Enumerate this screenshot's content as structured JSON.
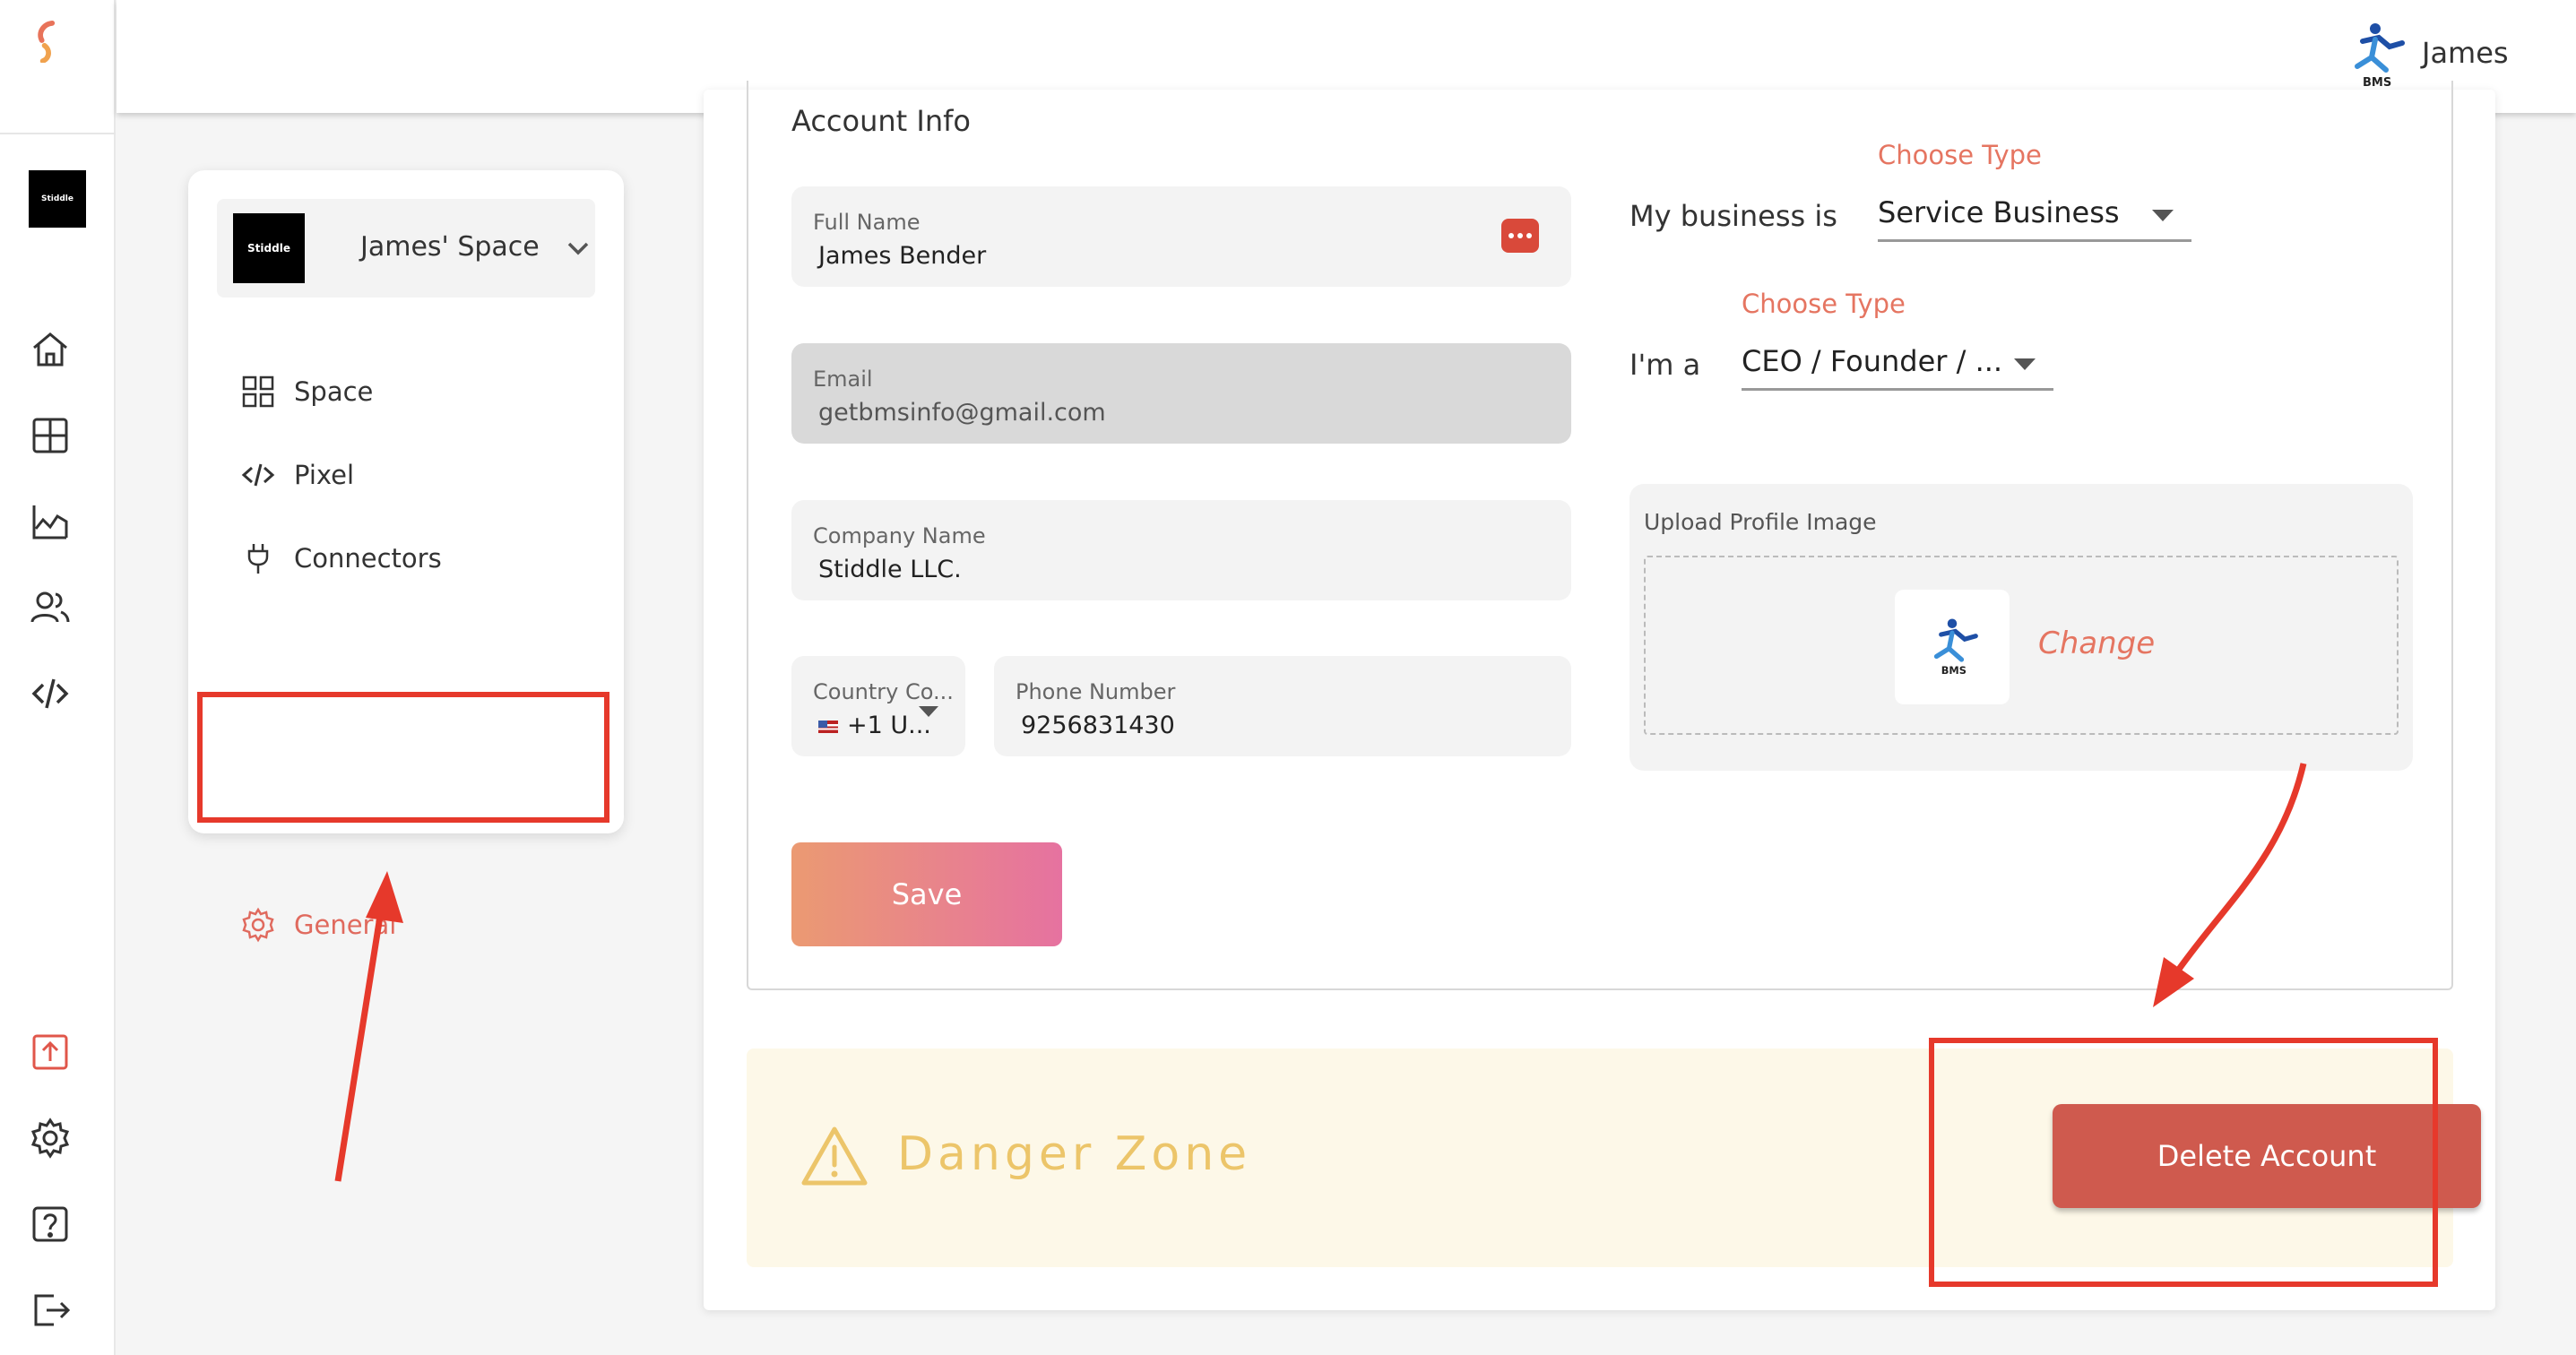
{
  "user": {
    "name": "James",
    "avatar_icon": "bms-logo-icon",
    "avatar_caption": "BMS"
  },
  "rail": {
    "workspace_thumb": "Stiddle",
    "icons": [
      "home-icon",
      "dashboard-icon",
      "analytics-icon",
      "users-icon",
      "code-icon",
      "upload-icon",
      "settings-icon",
      "help-icon",
      "logout-icon"
    ]
  },
  "space_menu": {
    "workspace_name": "James' Space",
    "workspace_thumb": "Stiddle",
    "items": [
      {
        "label": "Space",
        "icon": "grid-icon"
      },
      {
        "label": "Pixel",
        "icon": "code-icon"
      },
      {
        "label": "Connectors",
        "icon": "plug-icon"
      }
    ],
    "general_label": "General"
  },
  "account": {
    "section_title": "Account Info",
    "full_name": {
      "label": "Full Name",
      "value": "James Bender"
    },
    "email": {
      "label": "Email",
      "value": "getbmsinfo@gmail.com"
    },
    "company": {
      "label": "Company Name",
      "value": "Stiddle LLC."
    },
    "country_code": {
      "label": "Country Co...",
      "value": "+1 U..."
    },
    "phone": {
      "label": "Phone Number",
      "value": "9256831430"
    },
    "business": {
      "label": "My business is",
      "caption": "Choose Type",
      "value": "Service Business"
    },
    "role": {
      "label": "I'm a",
      "caption": "Choose Type",
      "value": "CEO / Founder / ..."
    },
    "upload": {
      "label": "Upload Profile Image",
      "change_label": "Change",
      "thumb_caption": "BMS"
    },
    "save_label": "Save"
  },
  "danger_zone": {
    "title": "Danger Zone",
    "delete_label": "Delete Account"
  },
  "colors": {
    "accent": "#e57561",
    "danger_button": "#cf5a4e",
    "highlight_box": "#e6392b",
    "danger_bg": "#fdf8e8",
    "warning": "#ecc56a"
  }
}
